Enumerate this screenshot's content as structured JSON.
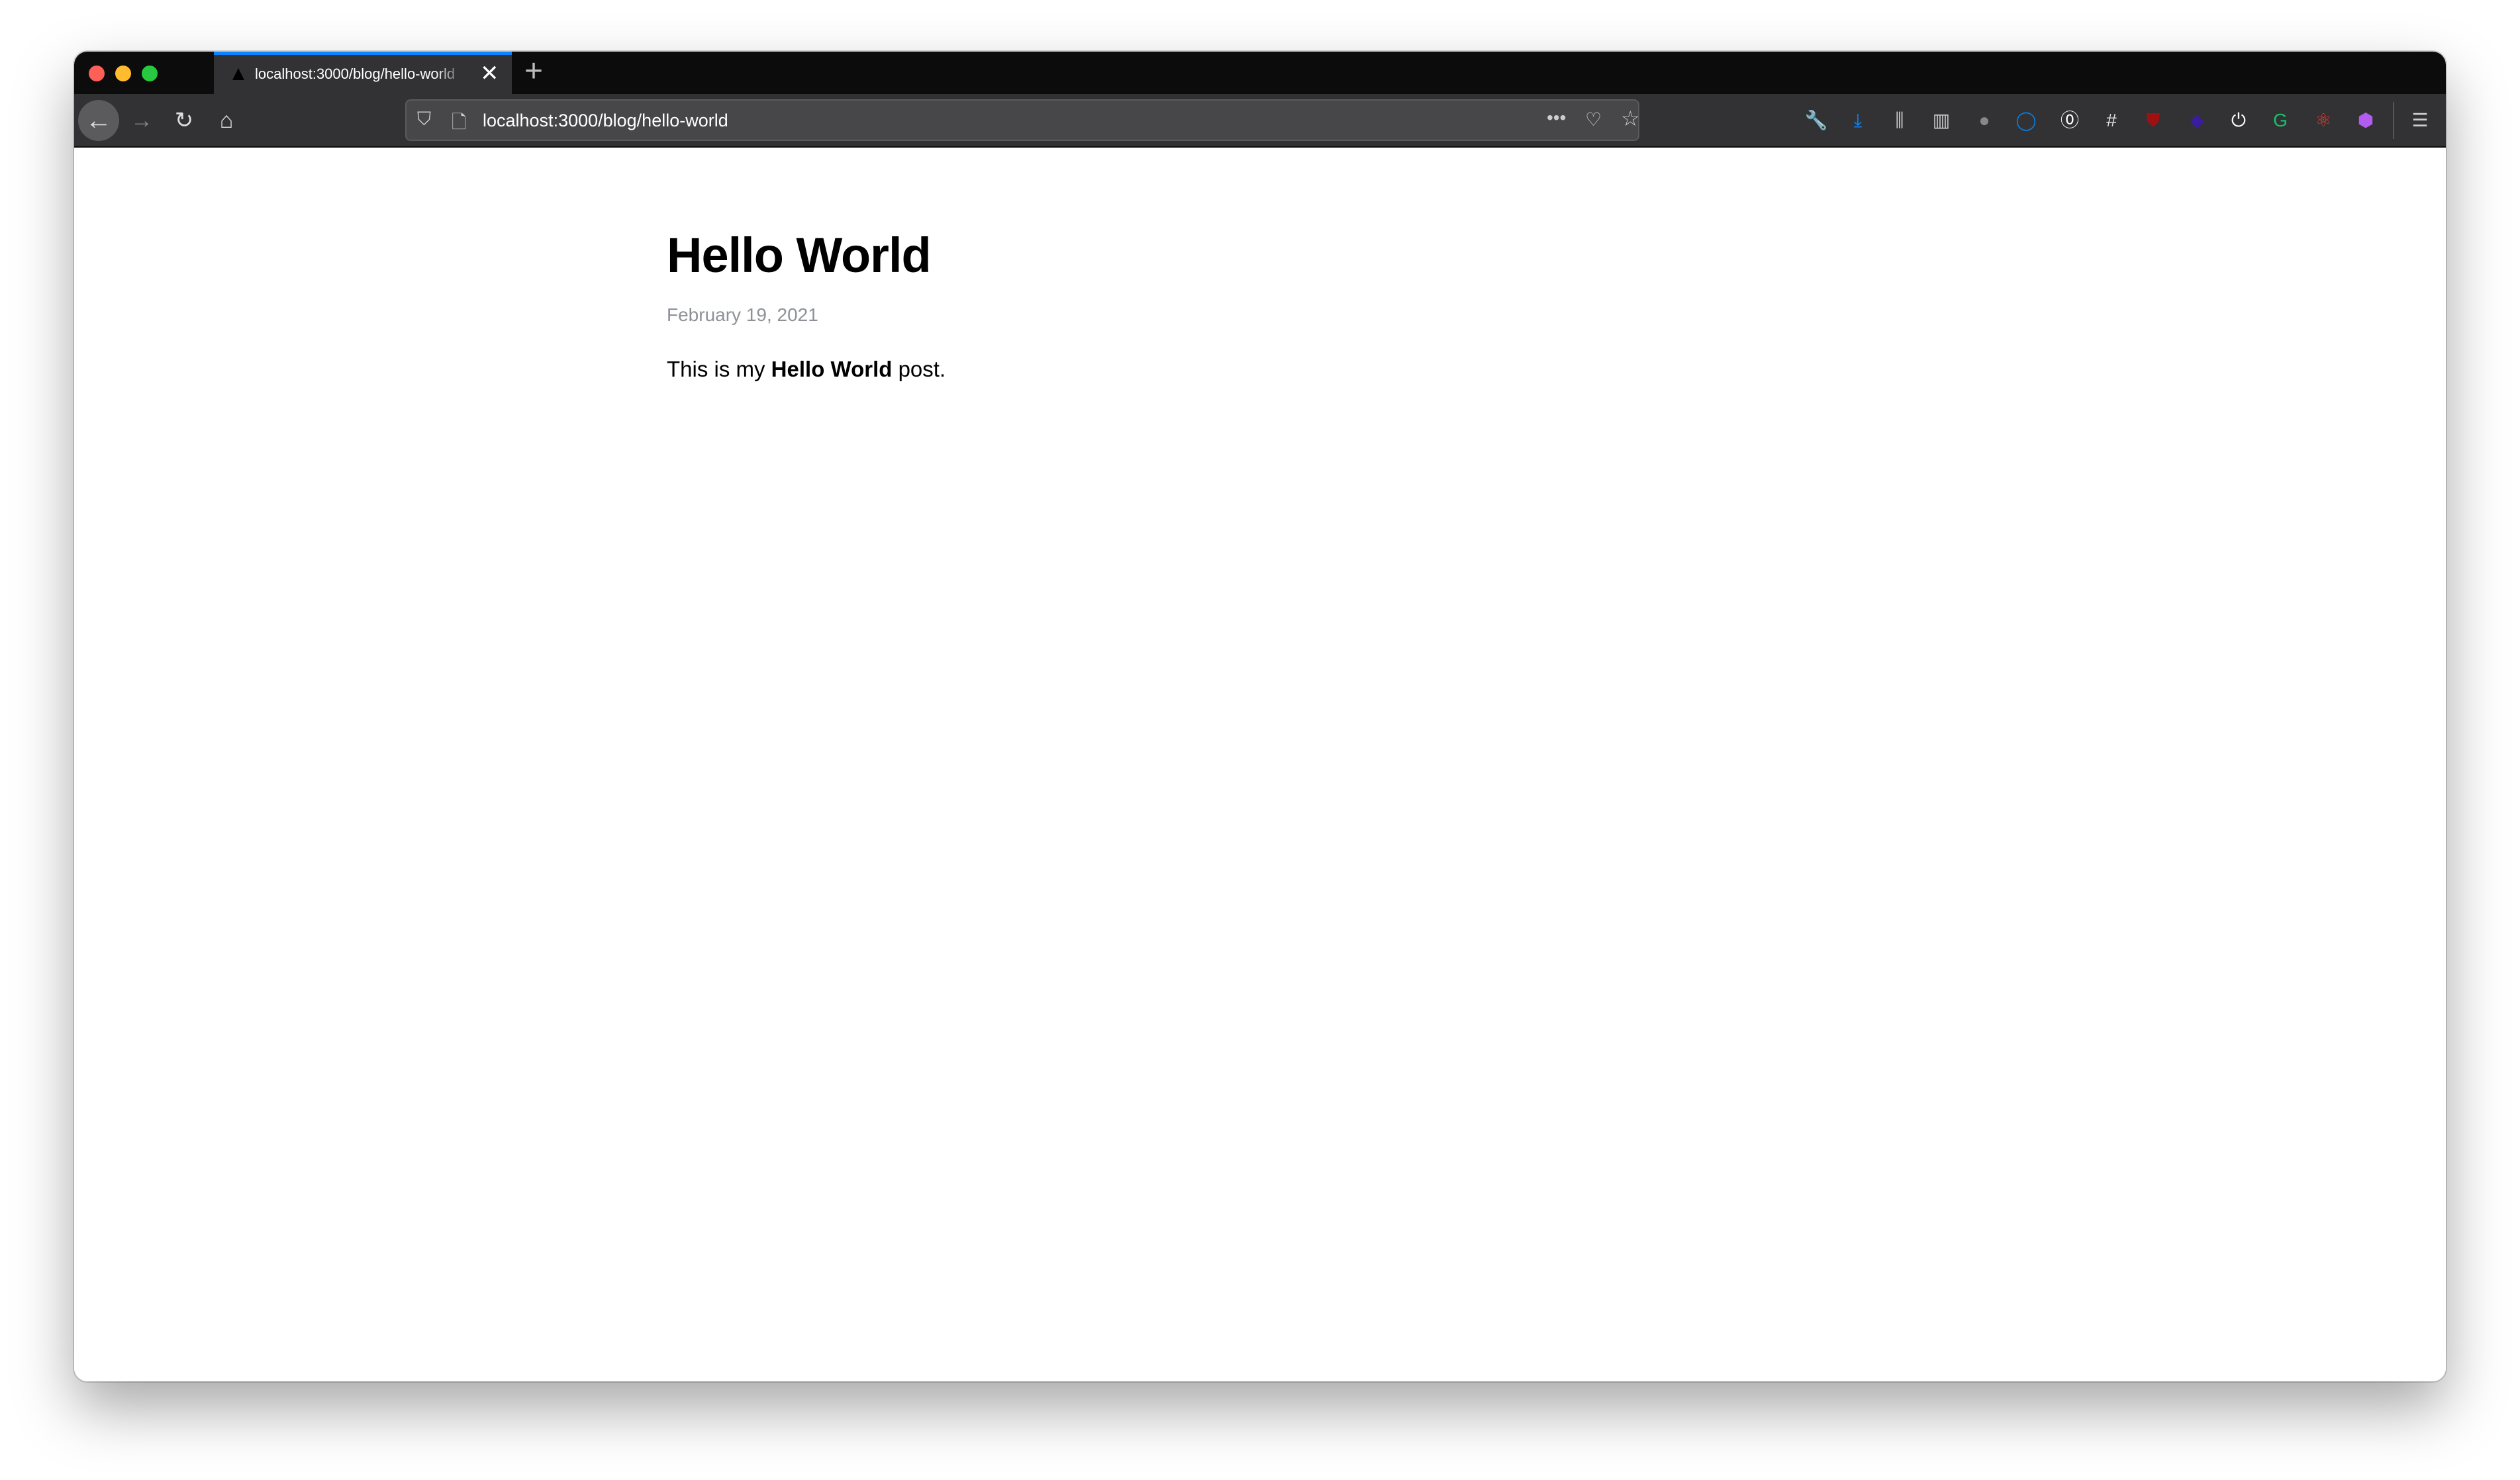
{
  "browser": {
    "tab": {
      "title": "localhost:3000/blog/hello-world",
      "close": "✕"
    },
    "new_tab": "+",
    "url": "localhost:3000/blog/hello-world",
    "nav": {
      "back": "←",
      "forward": "→",
      "reload": "↻",
      "home": "⌂"
    },
    "url_icons": {
      "shield": "⛉",
      "page": "🗋",
      "more": "•••",
      "pocket": "♡",
      "bookmark": "☆"
    },
    "extensions": [
      {
        "name": "wrench-icon",
        "glyph": "🔧",
        "color": "#cccccc"
      },
      {
        "name": "download-icon",
        "glyph": "⤓",
        "color": "#0a84ff"
      },
      {
        "name": "library-icon",
        "glyph": "⫼",
        "color": "#cccccc"
      },
      {
        "name": "sidebar-icon",
        "glyph": "▥",
        "color": "#cccccc"
      },
      {
        "name": "avatar-extension-icon",
        "glyph": "●",
        "color": "#888888"
      },
      {
        "name": "circle-extension-icon",
        "glyph": "◯",
        "color": "#0a7ad6"
      },
      {
        "name": "onepassword-icon",
        "glyph": "⓪",
        "color": "#ffffff"
      },
      {
        "name": "fence-icon",
        "glyph": "#",
        "color": "#dddddd"
      },
      {
        "name": "ublock-icon",
        "glyph": "⛊",
        "color": "#a01010"
      },
      {
        "name": "diamond-extension-icon",
        "glyph": "◆",
        "color": "#3a1d9e"
      },
      {
        "name": "power-icon",
        "glyph": "⏻",
        "color": "#ffffff"
      },
      {
        "name": "grammarly-icon",
        "glyph": "G",
        "color": "#15c26b"
      },
      {
        "name": "react-devtools-icon",
        "glyph": "⚛",
        "color": "#e63b2e"
      },
      {
        "name": "hex-extension-icon",
        "glyph": "⬢",
        "color": "#b25cf0"
      }
    ],
    "menu": "☰"
  },
  "post": {
    "title": "Hello World",
    "date": "February 19, 2021",
    "body_pre": "This is my ",
    "body_bold": "Hello World",
    "body_post": " post."
  }
}
